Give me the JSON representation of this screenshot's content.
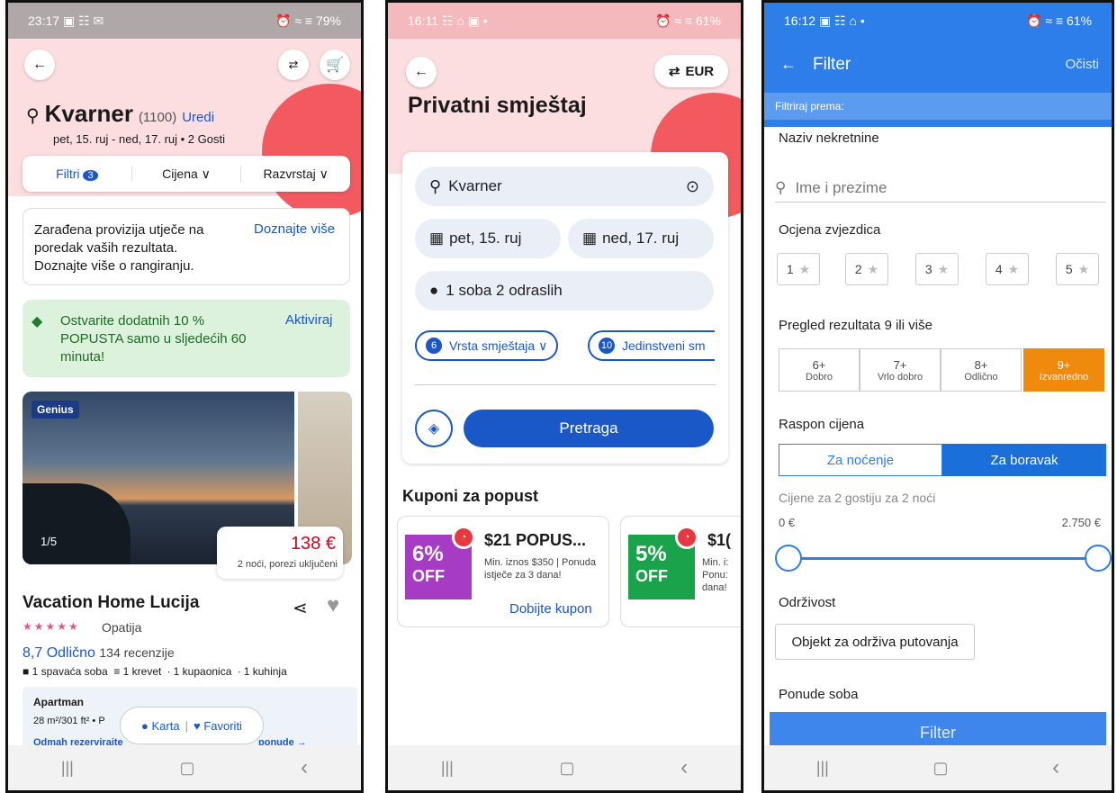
{
  "p1": {
    "status": {
      "time": "23:17",
      "icons": "▣ ☷ ✉",
      "right": "⏰ ≈ ≡ 79%"
    },
    "search": {
      "location": "Kvarner",
      "count": "(1100)",
      "edit": "Uredi",
      "dates": "pet, 15. ruj - ned, 17. ruj • 2 Gosti"
    },
    "filters": {
      "filter": "Filtri",
      "filter_badge": "3",
      "price": "Cijena ∨",
      "sort": "Razvrstaj ∨"
    },
    "commission": {
      "text": "Zarađena provizija utječe na poredak vaših rezultata. Doznajte više o rangiranju.",
      "link": "Doznajte više"
    },
    "promo": {
      "text": "Ostvarite dodatnih 10 % POPUSTA samo u sljedećih 60 minuta!",
      "link": "Aktiviraj"
    },
    "listing": {
      "genius": "Genius",
      "counter": "1/5",
      "price": "138 €",
      "price_note": "2 noći, porezi uključeni",
      "name": "Vacation Home Lucija",
      "stars": "★★★★★",
      "location": "Opatija",
      "rating": "8,7 Odlično",
      "reviews": "134 recenzije",
      "rooms": "1 spavaća soba  ≡ 1 krevet  ∙ 1 kupaonica  ∙ 1 kuhinja",
      "type": "Apartman",
      "size": "28 m²/301 ft² • P",
      "book": "Odmah rezervirajte",
      "book_end": "ponude →"
    },
    "floating": {
      "map": "Karta",
      "fav": "Favoriti"
    }
  },
  "p2": {
    "status": {
      "time": "16:11",
      "icons": "☷ ⌂ ▣ •",
      "right": "⏰ ≈ ≡ 61%"
    },
    "currency": "EUR",
    "title": "Privatni smještaj",
    "search": "Kvarner",
    "checkin": "pet, 15. ruj",
    "checkout": "ned, 17. ruj",
    "guests": "1 soba 2 odraslih",
    "chips": [
      {
        "n": "6",
        "label": "Vrsta smještaja ∨"
      },
      {
        "n": "10",
        "label": "Jedinstveni sm"
      }
    ],
    "search_btn": "Pretraga",
    "coupons_title": "Kuponi za popust",
    "coupon1": {
      "pct": "6%",
      "off": "OFF",
      "title": "$21 POPUS...",
      "desc": "Min. iznos $350 | Ponuda istječe za 3 dana!",
      "cta": "Dobijte kupon",
      "color": "#a63bc4"
    },
    "coupon2": {
      "pct": "5%",
      "off": "OFF",
      "title": "$1(",
      "desc": "Min. i: Ponu: dana!",
      "color": "#1aa34a"
    }
  },
  "p3": {
    "status": {
      "time": "16:12",
      "icons": "▣ ☷ ⌂ •",
      "right": "⏰ ≈ ≡ 61%"
    },
    "header": {
      "title": "Filter",
      "clear": "Očisti"
    },
    "subheader": "Filtriraj prema:",
    "name_section": "Naziv nekretnine",
    "name_placeholder": "Ime i prezime",
    "stars_section": "Ocjena zvjezdica",
    "stars": [
      "1",
      "2",
      "3",
      "4",
      "5"
    ],
    "reviews_section": "Pregled rezultata 9 ili više",
    "scores": [
      {
        "v": "6+",
        "l": "Dobro"
      },
      {
        "v": "7+",
        "l": "Vrlo dobro"
      },
      {
        "v": "8+",
        "l": "Odlično"
      },
      {
        "v": "9+",
        "l": "Izvanredno"
      }
    ],
    "price_section": "Raspon cijena",
    "price_tabs": [
      "Za noćenje",
      "Za boravak"
    ],
    "price_note": "Cijene za 2 gostiju za 2 noći",
    "price_min": "0 €",
    "price_max": "2.750 €",
    "sustain_section": "Održivost",
    "sustain_btn": "Objekt za održiva putovanja",
    "rooms_section": "Ponude soba",
    "filter_btn": "Filter"
  },
  "nav": {
    "recent": "|||",
    "home": "▢",
    "back": "‹"
  },
  "colors": {
    "booking_blue": "#1a57c7",
    "header_blue": "#2d7ee8",
    "orange": "#f08a0c",
    "pink": "#fcdde0",
    "coral": "#f25a5f"
  }
}
